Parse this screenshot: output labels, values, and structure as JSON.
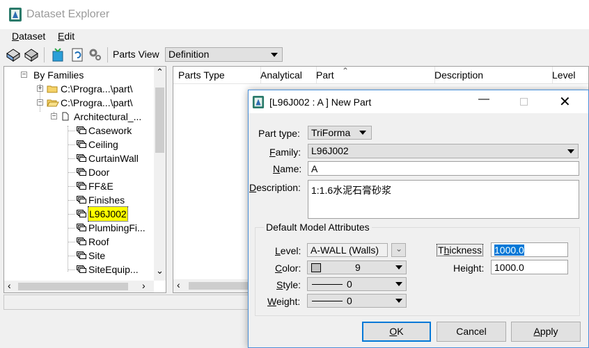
{
  "window": {
    "title": "Dataset Explorer"
  },
  "menu": [
    {
      "label": "Dataset"
    },
    {
      "label": "Edit"
    }
  ],
  "toolbar": {
    "parts_view_label": "Parts View",
    "parts_view_value": "Definition"
  },
  "tree": {
    "root": "By Families",
    "drive1": "C:\\Progra...\\part\\",
    "drive2": "C:\\Progra...\\part\\",
    "folder": "Architectural_...",
    "items": [
      "Casework",
      "Ceiling",
      "CurtainWall",
      "Door",
      "FF&E",
      "Finishes",
      "L96J002",
      "PlumbingFi...",
      "Roof",
      "Site",
      "SiteEquip..."
    ]
  },
  "columns": [
    "Parts Type",
    "Analytical",
    "Part",
    "Description",
    "Level"
  ],
  "dialog": {
    "title": "[L96J002 : A ] New Part",
    "part_type_label": "Part type:",
    "part_type_value": "TriForma",
    "family_label": "Family:",
    "family_value": "L96J002",
    "name_label": "Name:",
    "name_value": "A",
    "description_label": "Description:",
    "description_value": "1:1.6水泥石膏砂浆",
    "group_label": "Default Model Attributes",
    "level_label": "Level:",
    "level_value": "A-WALL (Walls)",
    "color_label": "Color:",
    "color_value": "9",
    "style_label": "Style:",
    "style_value": "0",
    "weight_label": "Weight:",
    "weight_value": "0",
    "thickness_label": "Thickness",
    "thickness_value": "1000.0",
    "height_label": "Height:",
    "height_value": "1000.0",
    "ok": "OK",
    "cancel": "Cancel",
    "apply": "Apply"
  },
  "colors": {
    "selection_highlight": "#ffff00",
    "text_selection": "#0078d7",
    "dialog_border": "#4a90d9"
  }
}
